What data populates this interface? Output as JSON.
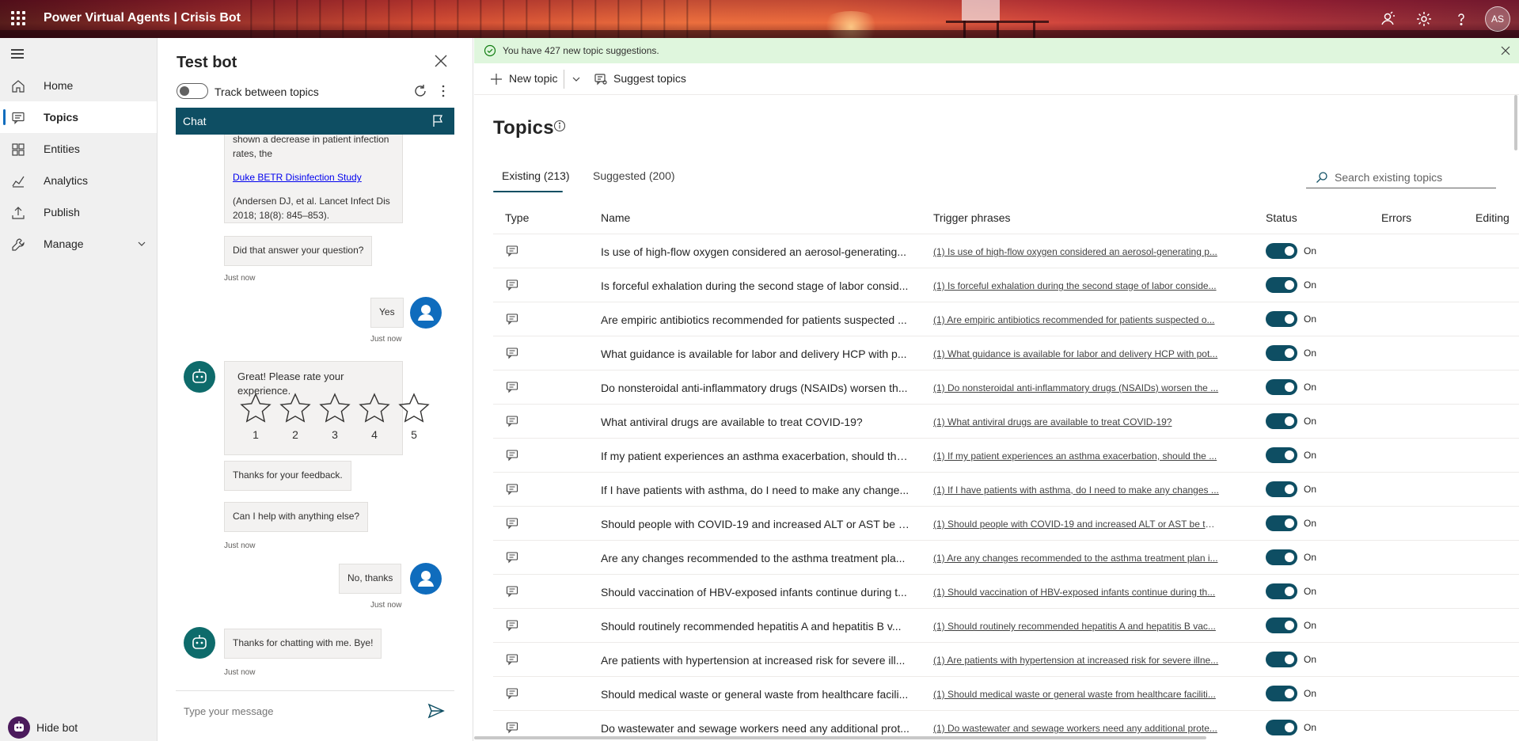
{
  "header": {
    "title": "Power Virtual Agents | Crisis Bot",
    "icons": [
      "waffle-icon",
      "person-feedback-icon",
      "gear-icon",
      "help-icon"
    ],
    "avatar_initials": "AS"
  },
  "nav": {
    "items": [
      {
        "label": "Home",
        "icon": "home-icon"
      },
      {
        "label": "Topics",
        "icon": "chat-icon"
      },
      {
        "label": "Entities",
        "icon": "entities-icon"
      },
      {
        "label": "Analytics",
        "icon": "analytics-icon"
      },
      {
        "label": "Publish",
        "icon": "publish-icon"
      },
      {
        "label": "Manage",
        "icon": "wrench-icon"
      }
    ],
    "hide_bot": "Hide bot"
  },
  "testbot": {
    "title": "Test bot",
    "track_label": "Track between topics",
    "chat_label": "Chat",
    "messages": {
      "cut_text": "shown a decrease in patient infection rates, the",
      "link": "Duke BETR Disinfection Study",
      "citation": "(Andersen DJ, et al. Lancet Infect Dis 2018; 18(8): 845–853).",
      "did_answer": "Did that answer your question?",
      "ts1": "Just now",
      "user_yes": "Yes",
      "ts2": "Just now",
      "rate": "Great! Please rate your experience.",
      "stars": [
        "1",
        "2",
        "3",
        "4",
        "5"
      ],
      "thanks_feedback": "Thanks for your feedback.",
      "help_else": "Can I help with anything else?",
      "ts3": "Just now",
      "user_no": "No, thanks",
      "ts4": "Just now",
      "bye": "Thanks for chatting with me. Bye!",
      "ts5": "Just now"
    },
    "input_placeholder": "Type your message"
  },
  "main": {
    "banner": "You have 427 new topic suggestions.",
    "new_topic": "New topic",
    "suggest_topics": "Suggest topics",
    "page_title": "Topics",
    "tabs": [
      "Existing (213)",
      "Suggested (200)"
    ],
    "search_placeholder": "Search existing topics",
    "columns": [
      "Type",
      "Name",
      "Trigger phrases",
      "Status",
      "Errors",
      "Editing"
    ],
    "status_on": "On",
    "rows": [
      {
        "name": "Is use of high-flow oxygen considered an aerosol-generating...",
        "trigger": "(1) Is use of high-flow oxygen considered an aerosol-generating p..."
      },
      {
        "name": "Is forceful exhalation during the second stage of labor consid...",
        "trigger": "(1) Is forceful exhalation during the second stage of labor conside..."
      },
      {
        "name": "Are empiric antibiotics recommended for patients suspected ...",
        "trigger": "(1) Are empiric antibiotics recommended for patients suspected o..."
      },
      {
        "name": "What guidance is available for labor and delivery HCP with p...",
        "trigger": "(1) What guidance is available for labor and delivery HCP with pot..."
      },
      {
        "name": "Do nonsteroidal anti-inflammatory drugs (NSAIDs) worsen th...",
        "trigger": "(1) Do nonsteroidal anti-inflammatory drugs (NSAIDs) worsen the ..."
      },
      {
        "name": "What antiviral drugs are available to treat COVID-19?",
        "trigger": "(1) What antiviral drugs are available to treat COVID-19?"
      },
      {
        "name": "If my patient experiences an asthma exacerbation, should the...",
        "trigger": "(1) If my patient experiences an asthma exacerbation, should the ..."
      },
      {
        "name": "If I have patients with asthma, do I need to make any change...",
        "trigger": "(1) If I have patients with asthma, do I need to make any changes ..."
      },
      {
        "name": "Should people with COVID-19 and increased ALT or AST be t...",
        "trigger": "(1) Should people with COVID-19 and increased ALT or AST be tes..."
      },
      {
        "name": "Are any changes recommended to the asthma treatment pla...",
        "trigger": "(1) Are any changes recommended to the asthma treatment plan i..."
      },
      {
        "name": "Should vaccination of HBV-exposed infants continue during t...",
        "trigger": "(1) Should vaccination of HBV-exposed infants continue during th..."
      },
      {
        "name": "Should routinely recommended hepatitis A and hepatitis B v...",
        "trigger": "(1) Should routinely recommended hepatitis A and hepatitis B vac..."
      },
      {
        "name": "Are patients with hypertension at increased risk for severe ill...",
        "trigger": "(1) Are patients with hypertension at increased risk for severe illne..."
      },
      {
        "name": "Should medical waste or general waste from healthcare facili...",
        "trigger": "(1) Should medical waste or general waste from healthcare faciliti..."
      },
      {
        "name": "Do wastewater and sewage workers need any additional prot...",
        "trigger": "(1) Do wastewater and sewage workers need any additional prote..."
      }
    ]
  }
}
